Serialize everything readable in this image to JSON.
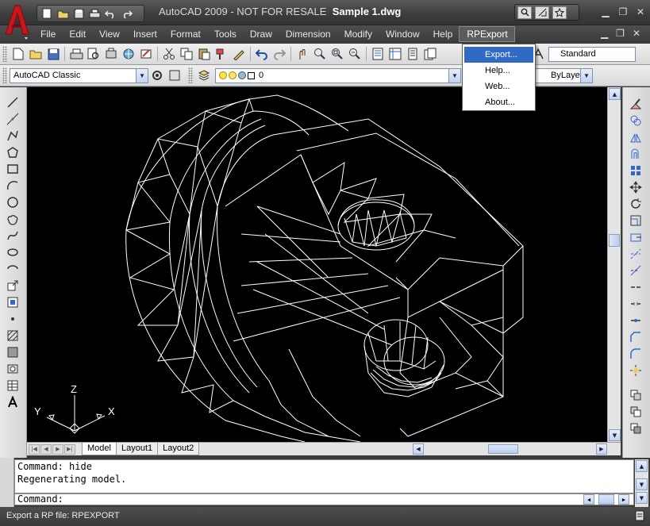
{
  "window": {
    "title_app": "AutoCAD 2009 - NOT FOR RESALE",
    "title_file": "Sample 1.dwg"
  },
  "menubar": {
    "items": [
      "File",
      "Edit",
      "View",
      "Insert",
      "Format",
      "Tools",
      "Draw",
      "Dimension",
      "Modify",
      "Window",
      "Help",
      "RPExport"
    ],
    "active": "RPExport"
  },
  "dropdown": {
    "items": [
      "Export...",
      "Help...",
      "Web...",
      "About..."
    ],
    "highlighted": "Export..."
  },
  "toolbar": {
    "text_style": "Standard",
    "workspace": "AutoCAD Classic",
    "layer": "0",
    "linetype": "ByLayer"
  },
  "layout_tabs": [
    "Model",
    "Layout1",
    "Layout2"
  ],
  "active_tab": "Model",
  "ucs": {
    "z": "Z",
    "y": "Y",
    "x": "X"
  },
  "command": {
    "history": [
      "Command: hide",
      "Regenerating model."
    ],
    "prompt": "Command:"
  },
  "status": {
    "text": "Export a RP file: RPEXPORT"
  },
  "colors": {
    "drawing_bg": "#000000",
    "wire": "#ffffff",
    "highlight": "#316ac5",
    "logo_red": "#c8161d"
  }
}
